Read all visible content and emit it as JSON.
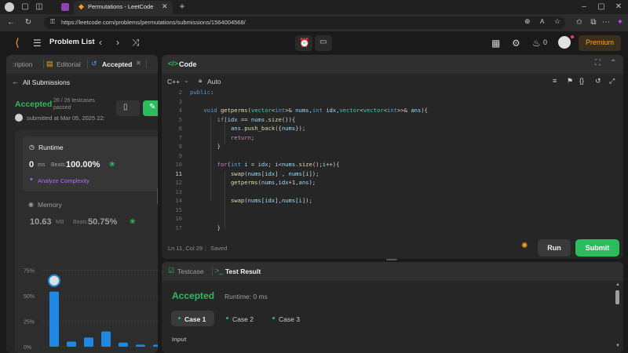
{
  "browser": {
    "tab_title": "Permutations - LeetCode",
    "url": "https://leetcode.com/problems/permutations/submissions/1564004568/"
  },
  "nav": {
    "problem_list": "Problem List",
    "streak": "0",
    "premium": "Premium"
  },
  "left": {
    "tabs": [
      ":ription",
      "Editorial",
      "Accepted"
    ],
    "all_submissions": "All Submissions",
    "status": "Accepted",
    "testcases": "26 / 26 testcases",
    "passed": "passed",
    "submitted": "submitted at Mar 05, 2025 22:",
    "runtime_label": "Runtime",
    "runtime_value": "0",
    "runtime_unit": "ms",
    "beats_label": "Beats",
    "runtime_beats": "100.00%",
    "analyze": "Analyze Complexity",
    "memory_label": "Memory",
    "memory_value": "10.63",
    "memory_unit": "MB",
    "memory_beats_label": "Beats",
    "memory_beats": "50.75%",
    "chart_ticks": [
      "75%",
      "50%",
      "25%",
      "0%"
    ]
  },
  "chart_data": {
    "type": "bar",
    "values": [
      54,
      5,
      9,
      15,
      4,
      2,
      2
    ],
    "ylim": [
      0,
      80
    ],
    "yticks": [
      75,
      50,
      25,
      0
    ],
    "ytick_labels": [
      "75%",
      "50%",
      "25%",
      "0%"
    ],
    "highlight_index": 0,
    "bar_color": "#1e88e5"
  },
  "code": {
    "title": "Code",
    "language": "C++",
    "mode": "Auto",
    "lines": [
      {
        "n": "2",
        "html": "<span class=\"kw\">public</span>:"
      },
      {
        "n": "3",
        "html": ""
      },
      {
        "n": "4",
        "html": "    <span class=\"kw\">void</span> <span class=\"fn\">getperms</span>(<span class=\"ty\">vector</span>&lt;<span class=\"kw\">int</span>&gt;&amp; <span class=\"va\">nums</span>,<span class=\"kw\">int</span> <span class=\"va\">idx</span>,<span class=\"ty\">vector</span>&lt;<span class=\"ty\">vector</span>&lt;<span class=\"kw\">int</span>&gt;&gt;&amp; <span class=\"va\">ans</span>){"
      },
      {
        "n": "5",
        "html": "        <span class=\"ctl\">if</span>(<span class=\"va\">idx</span> == <span class=\"va\">nums</span>.<span class=\"fn\">size</span>()){"
      },
      {
        "n": "6",
        "html": "            <span class=\"va\">ans</span>.<span class=\"fn\">push_back</span>({<span class=\"va\">nums</span>});"
      },
      {
        "n": "7",
        "html": "            <span class=\"ctl\">return</span>;"
      },
      {
        "n": "8",
        "html": "        }"
      },
      {
        "n": "9",
        "html": ""
      },
      {
        "n": "10",
        "html": "        <span class=\"ctl\">for</span>(<span class=\"kw\">int</span> <span class=\"va\">i</span> = <span class=\"va\">idx</span>; <span class=\"va\">i</span>&lt;<span class=\"va\">nums</span>.<span class=\"fn\">size</span>();<span class=\"va\">i</span>++){"
      },
      {
        "n": "11",
        "html": "            <span class=\"fn\">swap</span>(<span class=\"va\">nums</span>[<span class=\"va\">idx</span>] , <span class=\"va\">nums</span>[<span class=\"va\">i</span>]);"
      },
      {
        "n": "12",
        "html": "            <span class=\"fn\">getperms</span>(<span class=\"va\">nums</span>,<span class=\"va\">idx</span>+1,<span class=\"va\">ans</span>);"
      },
      {
        "n": "13",
        "html": ""
      },
      {
        "n": "14",
        "html": "            <span class=\"fn\">swap</span>(<span class=\"va\">nums</span>[<span class=\"va\">idx</span>],<span class=\"va\">nums</span>[<span class=\"va\">i</span>]);"
      },
      {
        "n": "15",
        "html": ""
      },
      {
        "n": "16",
        "html": ""
      },
      {
        "n": "17",
        "html": "        }"
      }
    ],
    "active_line": "11",
    "status": "Ln 11, Col 29",
    "saved": "Saved",
    "run": "Run",
    "submit": "Submit"
  },
  "result": {
    "tab_testcase": "Testcase",
    "tab_result": "Test Result",
    "status": "Accepted",
    "runtime": "Runtime: 0 ms",
    "cases": [
      "Case 1",
      "Case 2",
      "Case 3"
    ],
    "input_label": "Input"
  },
  "colors": {
    "accepted": "#2cbb5d",
    "premium": "#ffa116",
    "run_bg": "#3a3a3a",
    "submit_bg": "#2cbb5d",
    "bar": "#1e88e5"
  }
}
